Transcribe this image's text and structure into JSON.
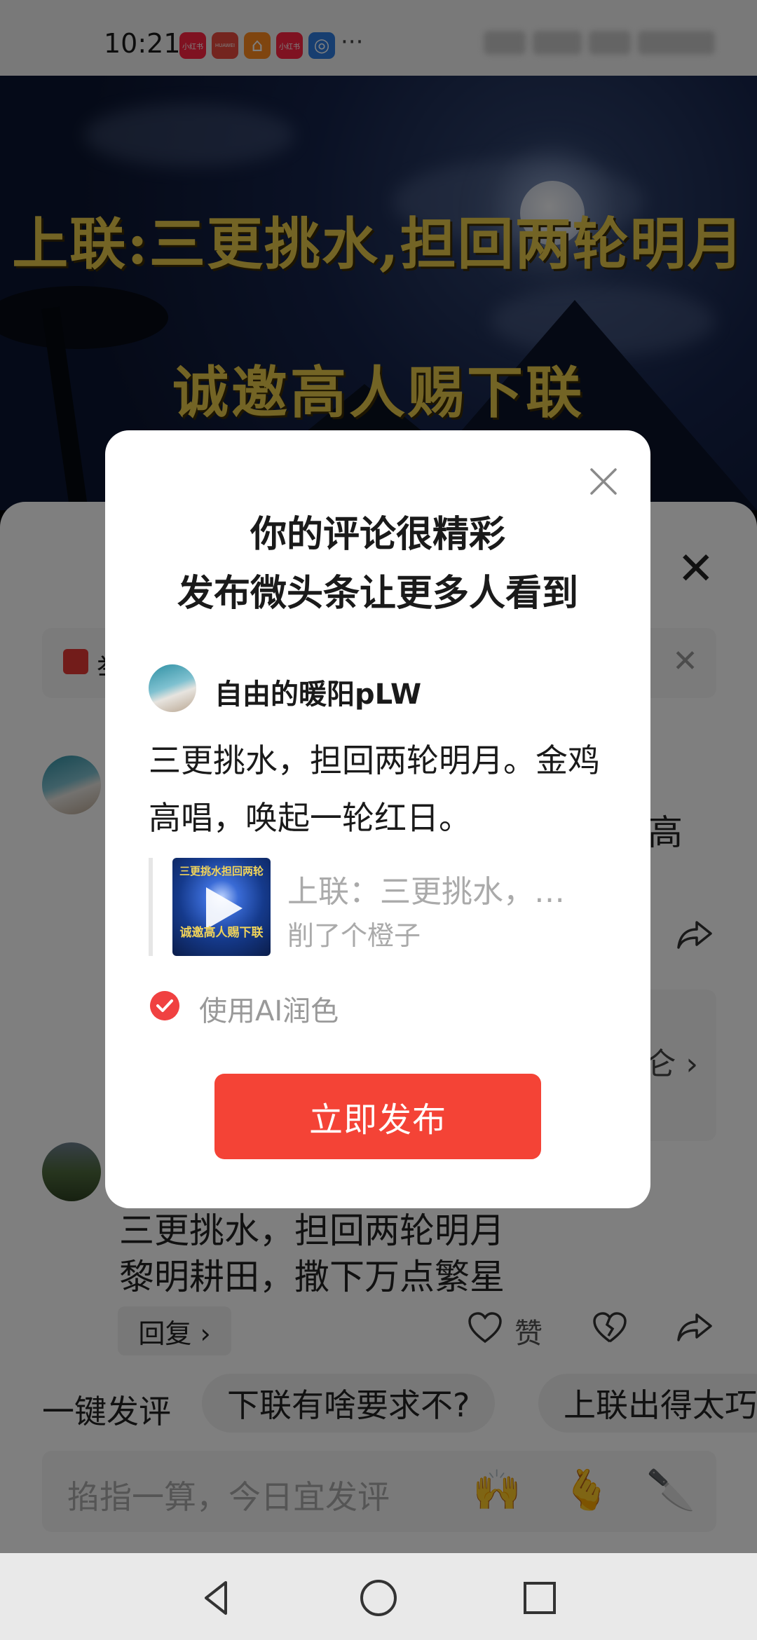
{
  "status_bar": {
    "time": "10:21",
    "app_icons": [
      {
        "name": "xiaohongshu-icon",
        "text": "小红书",
        "color": "#ff2442"
      },
      {
        "name": "huawei-icon",
        "text": "HUAWEI",
        "color": "#e84a3e"
      },
      {
        "name": "home-app-icon",
        "text": "⌂",
        "color": "#ff8a1e"
      },
      {
        "name": "xiaohongshu-icon-2",
        "text": "小红书",
        "color": "#ff2442"
      },
      {
        "name": "browser-icon",
        "text": "◎",
        "color": "#2f7de1"
      }
    ],
    "more": "···"
  },
  "banner": {
    "line1": "上联:三更挑水,担回两轮明月",
    "line2": "诚邀高人赐下联"
  },
  "sheet": {
    "notice_text": "举",
    "comment1_tail": "高",
    "reply_box_more": "仑 ›",
    "comment2_line1": "三更挑水，担回两轮明月",
    "comment2_line2": "黎明耕田，撒下万点繁星",
    "reply_label": "回复 ›",
    "like_label": "赞",
    "quick_label": "一键发评",
    "chips": [
      "下联有啥要求不?",
      "上联出得太巧"
    ],
    "input_placeholder": "掐指一算，今日宜发评",
    "emojis": [
      "🙌",
      "🫰",
      "🔪"
    ]
  },
  "modal": {
    "title_line1": "你的评论很精彩",
    "title_line2": "发布微头条让更多人看到",
    "username": "自由的暖阳pLW",
    "comment": "三更挑水，担回两轮明月。金鸡高唱，唤起一轮红日。",
    "quote_title": "上联：三更挑水，…",
    "quote_author": "削了个橙子",
    "thumb_line1": "三更挑水担回两轮",
    "thumb_line2": "诚邀高人赐下联",
    "ai_polish_label": "使用AI润色",
    "ai_polish_checked": true,
    "publish_label": "立即发布"
  },
  "colors": {
    "accent": "#f44336",
    "banner_text": "#e7c84a"
  }
}
